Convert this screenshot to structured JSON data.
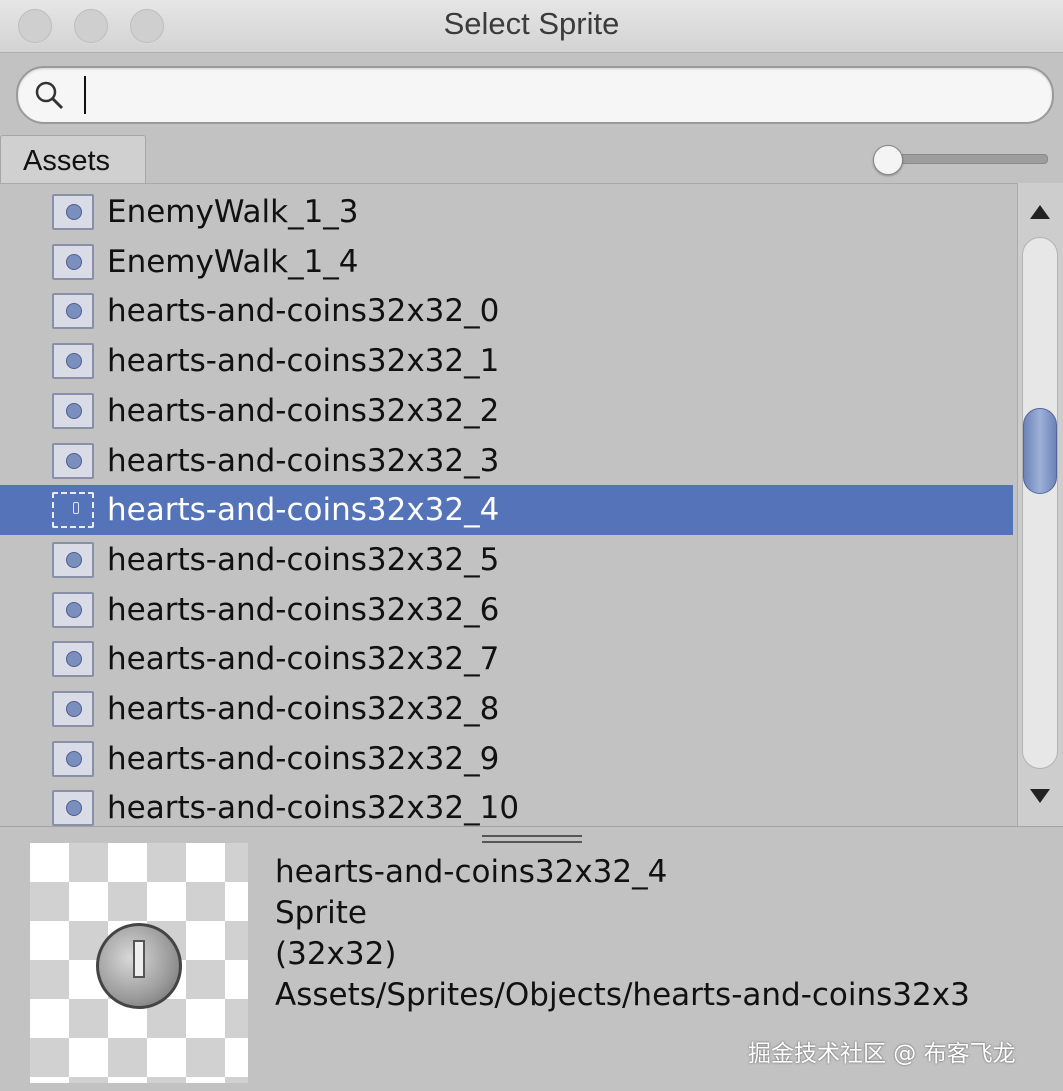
{
  "window": {
    "title": "Select Sprite"
  },
  "search": {
    "value": "",
    "placeholder": ""
  },
  "toolbar": {
    "tab_label": "Assets"
  },
  "list": {
    "items": [
      {
        "label": "EnemyWalk_1_3",
        "selected": false
      },
      {
        "label": "EnemyWalk_1_4",
        "selected": false
      },
      {
        "label": "hearts-and-coins32x32_0",
        "selected": false
      },
      {
        "label": "hearts-and-coins32x32_1",
        "selected": false
      },
      {
        "label": "hearts-and-coins32x32_2",
        "selected": false
      },
      {
        "label": "hearts-and-coins32x32_3",
        "selected": false
      },
      {
        "label": "hearts-and-coins32x32_4",
        "selected": true
      },
      {
        "label": "hearts-and-coins32x32_5",
        "selected": false
      },
      {
        "label": "hearts-and-coins32x32_6",
        "selected": false
      },
      {
        "label": "hearts-and-coins32x32_7",
        "selected": false
      },
      {
        "label": "hearts-and-coins32x32_8",
        "selected": false
      },
      {
        "label": "hearts-and-coins32x32_9",
        "selected": false
      },
      {
        "label": "hearts-and-coins32x32_10",
        "selected": false
      }
    ]
  },
  "preview": {
    "name": "hearts-and-coins32x32_4",
    "type": "Sprite",
    "size": "(32x32)",
    "path": "Assets/Sprites/Objects/hearts-and-coins32x3"
  },
  "watermark": "掘金技术社区 @ 布客飞龙",
  "colors": {
    "selection": "#5573b8",
    "background": "#c2c2c2"
  }
}
